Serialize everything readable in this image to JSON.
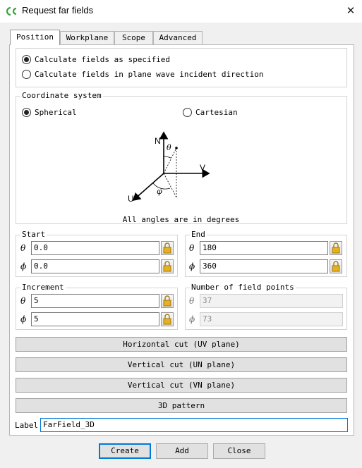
{
  "window": {
    "title": "Request far fields",
    "close_glyph": "✕"
  },
  "tabs": [
    {
      "label": "Position",
      "active": true
    },
    {
      "label": "Workplane",
      "active": false
    },
    {
      "label": "Scope",
      "active": false
    },
    {
      "label": "Advanced",
      "active": false
    }
  ],
  "mode": {
    "options": [
      {
        "label": "Calculate fields as specified",
        "selected": true
      },
      {
        "label": "Calculate fields in plane wave incident direction",
        "selected": false
      }
    ]
  },
  "coordinate_system": {
    "legend": "Coordinate system",
    "spherical_label": "Spherical",
    "spherical_selected": true,
    "cartesian_label": "Cartesian",
    "cartesian_selected": false,
    "diagram": {
      "n": "N",
      "u": "U",
      "v": "V",
      "theta": "θ",
      "phi": "φ"
    },
    "note": "All angles are in degrees"
  },
  "start": {
    "legend": "Start",
    "theta_label": "θ",
    "theta_value": "0.0",
    "phi_label": "ϕ",
    "phi_value": "0.0"
  },
  "end": {
    "legend": "End",
    "theta_label": "θ",
    "theta_value": "180",
    "phi_label": "ϕ",
    "phi_value": "360"
  },
  "increment": {
    "legend": "Increment",
    "theta_label": "θ",
    "theta_value": "5",
    "phi_label": "ϕ",
    "phi_value": "5"
  },
  "num_points": {
    "legend": "Number of field points",
    "theta_label": "θ",
    "theta_value": "37",
    "phi_label": "ϕ",
    "phi_value": "73"
  },
  "presets": {
    "horizontal": "Horizontal cut (UV plane)",
    "vertical_un": "Vertical cut (UN plane)",
    "vertical_vn": "Vertical cut (VN plane)",
    "pattern_3d": "3D pattern"
  },
  "label_field": {
    "label": "Label",
    "value": "FarField_3D"
  },
  "footer": {
    "create": "Create",
    "add": "Add",
    "close": "Close"
  },
  "colors": {
    "focus_blue": "#0078d7",
    "lock_yellow": "#e8b020",
    "app_icon_green": "#3aa13a"
  }
}
